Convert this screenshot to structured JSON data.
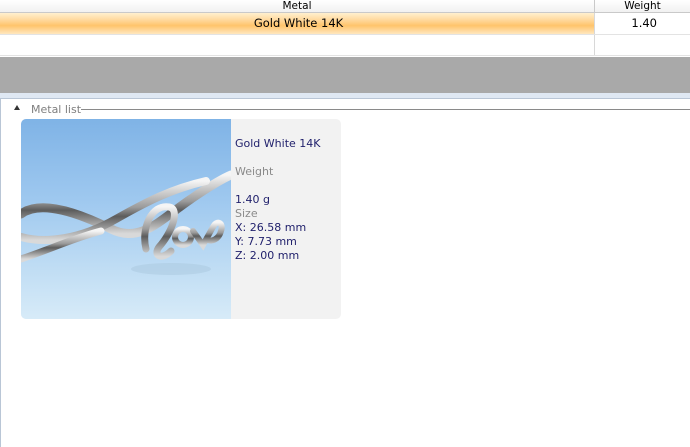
{
  "grid": {
    "columns": {
      "metal": "Metal",
      "weight": "Weight"
    },
    "rows": [
      {
        "metal": "Gold White 14K",
        "weight": "1.40"
      }
    ]
  },
  "panel": {
    "group_label": "Metal list",
    "card": {
      "metal_name": "Gold White 14K",
      "weight_label": "Weight",
      "weight_value": "1.40 g",
      "size_label": "Size",
      "x": "X: 26.58 mm",
      "y": "Y: 7.73 mm",
      "z": "Z: 2.00 mm"
    }
  },
  "colors": {
    "selected_row": "#ffc46b",
    "band": "#a9a9a9",
    "info_text": "#1f1f6b"
  }
}
